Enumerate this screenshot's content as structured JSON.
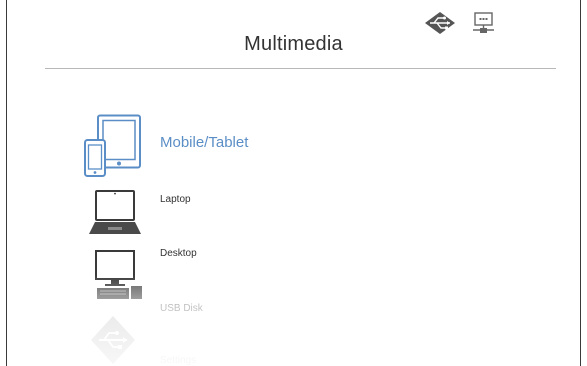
{
  "header": {
    "title": "Multimedia",
    "status_icons": [
      {
        "name": "usb-status-icon"
      },
      {
        "name": "network-status-icon"
      }
    ]
  },
  "menu": {
    "selected": "Mobile/Tablet",
    "items": [
      {
        "label": "Mobile/Tablet",
        "icon": "mobile-tablet-icon"
      },
      {
        "label": "Laptop",
        "icon": "laptop-icon"
      },
      {
        "label": "Desktop",
        "icon": "desktop-icon"
      },
      {
        "label": "USB Disk",
        "icon": "usb-disk-icon"
      },
      {
        "label": "Settings",
        "icon": "settings-icon"
      }
    ]
  },
  "colors": {
    "accent": "#5b8ec6",
    "text": "#333333",
    "divider": "#b8b8b8",
    "border": "#3a3a3a"
  }
}
